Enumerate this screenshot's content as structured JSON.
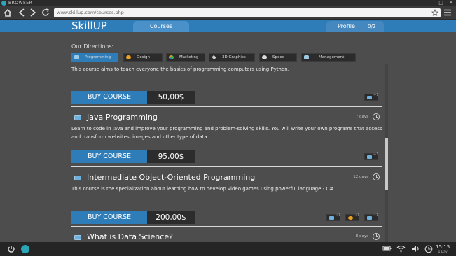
{
  "browser": {
    "title": "BROWSER",
    "url": "www.skillup.com/courses.php"
  },
  "site": {
    "brand": "SkillUP",
    "nav": {
      "courses": "Courses",
      "profile": "Profile",
      "profile_count": "0/2"
    }
  },
  "directions": {
    "title": "Our Directions:",
    "items": [
      {
        "label": "Programming",
        "icon": "keyboard-icon",
        "active": true
      },
      {
        "label": "Design",
        "icon": "palette-icon",
        "active": false
      },
      {
        "label": "Marketing",
        "icon": "chart-pie-icon",
        "active": false
      },
      {
        "label": "3D Graphics",
        "icon": "cube-icon",
        "active": false
      },
      {
        "label": "Speed",
        "icon": "stopwatch-icon",
        "active": false
      },
      {
        "label": "Management",
        "icon": "people-icon",
        "active": false
      }
    ]
  },
  "courses": [
    {
      "title": "",
      "days": "",
      "description": "This course aims to teach everyone the basics of programming computers using Python.",
      "buy_label": "BUY COURSE",
      "price": "50,00$",
      "badges": [
        "+1"
      ]
    },
    {
      "title": "Java Programming",
      "days": "7 days",
      "description": "Learn to code in Java and improve your programming and problem-solving skills. You will write your own programs that access and transform websites, images and other type of data.",
      "buy_label": "BUY COURSE",
      "price": "95,00$",
      "badges": [
        "+1"
      ]
    },
    {
      "title": "Intermediate Object-Oriented Programming",
      "days": "12 days",
      "description": "This course is the specialization about learning how to develop video games using powerful language - C#.",
      "buy_label": "BUY COURSE",
      "price": "200,00$",
      "badges": [
        "+1",
        "+1",
        "+1"
      ]
    },
    {
      "title": "What is Data Science?",
      "days": "8 days"
    }
  ],
  "taskbar": {
    "time": "15:15",
    "date": "1 Day"
  },
  "colors": {
    "accent": "#2f7db8",
    "background": "#4d4d4d",
    "dark": "#2c2c2c"
  }
}
